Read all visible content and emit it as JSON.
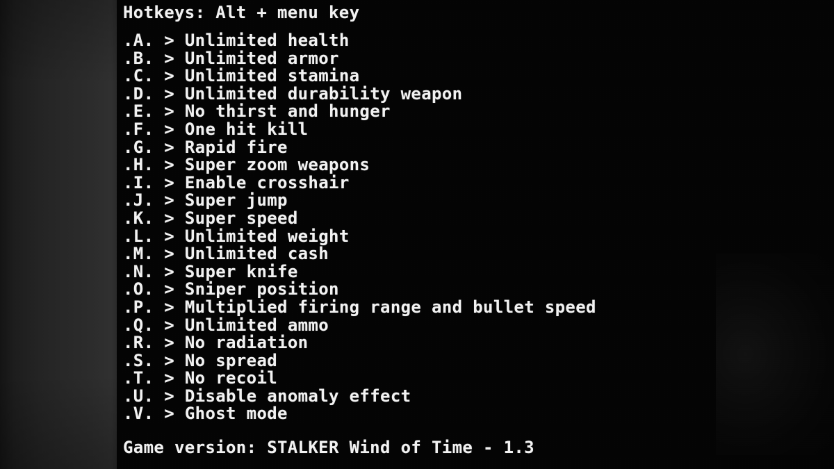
{
  "header": {
    "title": "Hotkeys: Alt + menu key"
  },
  "cheats": [
    {
      "key": ".A.",
      "arrow": ">",
      "label": "Unlimited health"
    },
    {
      "key": ".B.",
      "arrow": ">",
      "label": "Unlimited armor"
    },
    {
      "key": ".C.",
      "arrow": ">",
      "label": "Unlimited stamina"
    },
    {
      "key": ".D.",
      "arrow": ">",
      "label": "Unlimited durability weapon"
    },
    {
      "key": ".E.",
      "arrow": ">",
      "label": "No thirst and hunger"
    },
    {
      "key": ".F.",
      "arrow": ">",
      "label": "One hit kill"
    },
    {
      "key": ".G.",
      "arrow": ">",
      "label": "Rapid fire"
    },
    {
      "key": ".H.",
      "arrow": ">",
      "label": "Super zoom weapons"
    },
    {
      "key": ".I.",
      "arrow": ">",
      "label": "Enable crosshair"
    },
    {
      "key": ".J.",
      "arrow": ">",
      "label": "Super jump"
    },
    {
      "key": ".K.",
      "arrow": ">",
      "label": "Super speed"
    },
    {
      "key": ".L.",
      "arrow": ">",
      "label": "Unlimited weight"
    },
    {
      "key": ".M.",
      "arrow": ">",
      "label": "Unlimited cash"
    },
    {
      "key": ".N.",
      "arrow": ">",
      "label": "Super knife"
    },
    {
      "key": ".O.",
      "arrow": ">",
      "label": "Sniper position"
    },
    {
      "key": ".P.",
      "arrow": ">",
      "label": "Multiplied firing range and bullet speed"
    },
    {
      "key": ".Q.",
      "arrow": ">",
      "label": "Unlimited ammo"
    },
    {
      "key": ".R.",
      "arrow": ">",
      "label": "No radiation"
    },
    {
      "key": ".S.",
      "arrow": ">",
      "label": "No spread"
    },
    {
      "key": ".T.",
      "arrow": ">",
      "label": "No recoil"
    },
    {
      "key": ".U.",
      "arrow": ">",
      "label": "Disable anomaly effect"
    },
    {
      "key": ".V.",
      "arrow": ">",
      "label": "Ghost mode"
    }
  ],
  "footer": {
    "version_line": "Game version: STALKER Wind of Time - 1.3"
  },
  "colors": {
    "background": "#040404",
    "text": "#f2f2f2",
    "letterbox": "#2b2b2b"
  }
}
